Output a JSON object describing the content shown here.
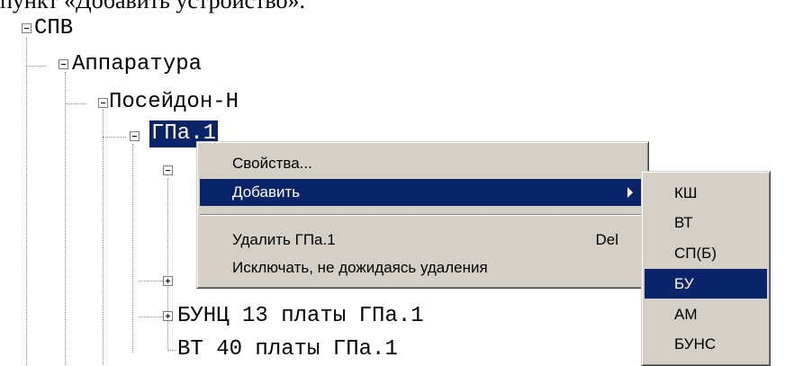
{
  "caption": "пункт «Добавить устройство».",
  "tree": {
    "spv": "СПВ",
    "apparatura": "Аппаратура",
    "poseidon": "Посейдон-Н",
    "gpa": "ГПа.1",
    "bunc": "БУНЦ 13 платы ГПа.1",
    "vt": "ВТ 40 платы ГПа.1"
  },
  "context_menu": {
    "properties": "Свойства...",
    "add": "Добавить",
    "delete": "Удалить ГПа.1",
    "delete_shortcut": "Del",
    "exclude": "Исключать, не дожидаясь удаления"
  },
  "submenu": {
    "items": [
      "КШ",
      "ВТ",
      "СП(Б)",
      "БУ",
      "АМ",
      "БУНС"
    ],
    "highlighted": "БУ"
  },
  "colors": {
    "selection": "#0a246a",
    "menu_bg": "#d4d0c8"
  }
}
